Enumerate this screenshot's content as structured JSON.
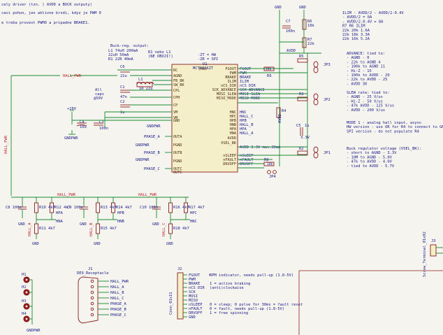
{
  "header_notes": [
    "cely driver (tzn.) AVDD a BUCK outputy)",
    "ze aktivni brzdi, kdyz je PWM 0",
    "provest PWMO a pripadne BRAKE1."
  ],
  "header_notes_real": [
    "cely driver (tzn. ) AVDD a BUCK outputy)",
    "cavi pohon, jen aktivne brzdi, kdyz je PWM 0",
    "e treba provest PWMO a pripadne BRAKE1."
  ],
  "colors": {
    "wire": "#198a32",
    "component": "#8b1c1c",
    "text": "#1a1a8c",
    "net": "#c0242b",
    "background": "#f5f4ef"
  },
  "gnd": "GND",
  "buck_note": [
    "Buck-reg. output:",
    "L1  74uH 200mA",
    "    22uH 50mA",
    "R1  22R 40mA"
  ],
  "r1_note": [
    "R1 nebo L1",
    "(NE OBOJI!)"
  ],
  "cap_note": [
    "All",
    "caps",
    "@50V"
  ],
  "u1": {
    "ref": "U1",
    "value": "MCT8316ZT",
    "hw_note": "-ZT = HW",
    "spi_note": "-ZR = SPI",
    "tag": "(HW)",
    "left_pins": [
      "RC",
      "AGND",
      "FB_BK",
      "SW_BK",
      "CPL",
      "CPH",
      "CP",
      "VM",
      "VM",
      "GND",
      "OUTA",
      "PGND",
      "OUTB",
      "PGND",
      "OUTC",
      "DVDD"
    ],
    "left_pins_real": [
      "RC",
      "AGND",
      "FB_BK",
      "SW_BK",
      "CPL",
      "CPH",
      "CP",
      "VM",
      "VM",
      "GND",
      "OUTA",
      "PGND",
      "OUTB",
      "PGND",
      "OUTC",
      "OUTC"
    ],
    "right_pins": [
      "FGOUT",
      "PWM",
      "BRAKE",
      "ILIM",
      "nCS DIR",
      "SCK ADVANCE",
      "MOSI SLEW",
      "MISO MODE",
      "HNC",
      "HALL_C",
      "HPB",
      "HALL_B",
      "HPA",
      "HALL_A",
      "AVDD",
      "VSEL_BK",
      "nSLEEP",
      "nFAULT",
      "DRVOFF"
    ],
    "right_pins_real": [
      "FGOUT",
      "PWM",
      "BRAKE",
      "ILIM",
      "nCS_DIR",
      "SCK_ADVANCE",
      "MOSI_SLEW",
      "MISO_MODE",
      "HNC",
      "HPC",
      "HPB",
      "HNB",
      "HPA",
      "HNA",
      "AVDD",
      "VSEL_BK",
      "nSLEEP",
      "nFAULT",
      "DRVOFF"
    ]
  },
  "left_components": [
    {
      "ref": "C6",
      "value": "22u"
    },
    {
      "ref": "C1",
      "value": "47n"
    },
    {
      "ref": "L1",
      "value": "1R"
    },
    {
      "ref": "R1",
      "value": "1R 22u"
    },
    {
      "ref": "C2",
      "value": "1u"
    },
    {
      "ref": "C4",
      "value": "10u"
    },
    {
      "ref": "C3",
      "value": "100n"
    }
  ],
  "left_labels": {
    "v28": "+28V",
    "gnd": "GND",
    "gndpwr": "GNDPWR",
    "hall_pwr": "HALL_PWR",
    "phase_a": "PHASE_A",
    "phase_b": "PHASE_B",
    "phase_c": "PHASE_C"
  },
  "right_labels": [
    "FGOUT",
    "PWM",
    "BRAKE",
    "ILIM",
    "nCS DIR",
    "SCK ADVANCE",
    "MOSI SLEW",
    "MISO MODE",
    "HNC",
    "HALL_C",
    "HPB",
    "HALL_B",
    "HPA",
    "HALL_A",
    "AVDD 3.3V max.30mA",
    "nSLEEP",
    "nFAULT",
    "DRVOFF"
  ],
  "right_components": [
    {
      "ref": "R9",
      "value": "10k"
    },
    {
      "ref": "R4",
      "value": "10k"
    },
    {
      "ref": "C5",
      "value": "1u"
    },
    {
      "ref": "R2",
      "value": "10k"
    },
    {
      "ref": "R8",
      "value": "10k"
    },
    {
      "ref": "JP4",
      "value": ""
    },
    {
      "ref": "R3",
      "value": "10k"
    },
    {
      "ref": "R5",
      "value": "10k"
    },
    {
      "ref": "C7",
      "value": "100n"
    },
    {
      "ref": "R6",
      "value": "18k"
    },
    {
      "ref": "R7",
      "value": "22k"
    }
  ],
  "jumpers": [
    "JP3",
    "JP2",
    "JP1"
  ],
  "avdd_label": "AVDD",
  "avdd_v": "3.3V",
  "ilim_note": [
    "ILIM - AVDD/2 - AVDD/2-0.4V",
    "- AVDD/2 = 0A",
    "- AVDD/2-0.4V = 8A",
    "R7   R6   ILIM",
    "22k  20k  1.6A",
    "22k  18k  3.3A",
    "22k  16k  5.2A"
  ],
  "advance_note": [
    "ADVANCE: tied to:",
    "- AGND - 0",
    "- 22k to AGND 4",
    "- 100k to AGND 11",
    "- Hi-Z - 15",
    "- 100k to AVDD - 20",
    "- 22k to AVDD - 25",
    "- AVDD 30"
  ],
  "slew_note": [
    "SLEW rate: tied to:",
    "- AGND - 25 V/us",
    "- Hi-Z - 50 V/us",
    "- 47k AVDD - 125 V/us",
    "- AVDD - 200 V/us"
  ],
  "mode_note": [
    "MODE 1 - analog hall input, async",
    "HW version - use OR for R4 to connect to GND",
    "SPI version - do not populate R4"
  ],
  "buck_v_note": [
    "Buck regulator voltage (VSEL_BK):",
    "- short to AGND - 3.3V",
    "- 10M to AGND - 5.0V",
    "- 47k to AVDD - 4.0V",
    "- tied to AVDD - 5.7V"
  ],
  "hall_sections": [
    {
      "caps": [
        {
          "ref": "C8",
          "value": "100n"
        }
      ],
      "res": [
        {
          "ref": "R10",
          "value": "4k7"
        },
        {
          "ref": "R11",
          "value": "4k7"
        }
      ],
      "net": "HALL_A",
      "hp": "HPA",
      "hn": "HNA",
      "r0": "R10",
      "r0v": "4k7"
    },
    {
      "caps": [
        {
          "ref": "C9",
          "value": "100n"
        }
      ],
      "res": [
        {
          "ref": "R13",
          "value": "4k7"
        },
        {
          "ref": "R14",
          "value": "4k7"
        },
        {
          "ref": "R15",
          "value": "4k7"
        }
      ],
      "net": "HALL_B",
      "hp": "HPB",
      "hn": "HNB"
    },
    {
      "caps": [
        {
          "ref": "C10",
          "value": "100n"
        }
      ],
      "res": [
        {
          "ref": "R16",
          "value": "4k7"
        },
        {
          "ref": "R17",
          "value": "4k7"
        },
        {
          "ref": "R18",
          "value": "4k7"
        }
      ],
      "net": "HALL_C",
      "hp": "HPC",
      "hn": "HNC"
    }
  ],
  "hall_sections_real": [
    {
      "cap": "C8 100n",
      "r_top": "R10 4k7",
      "r_mid": "R12 4k7",
      "r_bot": "R11 4k7",
      "net": "HALL_A",
      "hp": "HPA",
      "hn": "HNA"
    },
    {
      "cap": "C9 100n",
      "r_top": "R13 4k7",
      "r_mid": "R14 4k7",
      "r_bot": "R15 4k7",
      "net": "HALL_B",
      "hp": "HPB",
      "hn": "HNB"
    },
    {
      "cap": "C10 100n",
      "r_top": "R16 4k7",
      "r_mid": "R17 4k7",
      "r_bot": "R18 4k7",
      "net": "HALL_C",
      "hp": "HPC",
      "hn": "HNC"
    }
  ],
  "mounting_holes": [
    "H1",
    "H2",
    "H3",
    "H4"
  ],
  "j1": {
    "ref": "J1",
    "value": "DE9_Receptacle",
    "pins": [
      "HALL_PWR",
      "HALL_A",
      "HALL_B",
      "HALL_C",
      "PHASE_A",
      "PHASE_B",
      "PHASE_C"
    ]
  },
  "j2": {
    "ref": "J2",
    "value": "Conn_01x11",
    "pins": [
      "FGOUT",
      "PWM",
      "BRAKE",
      "nCS DIR",
      "SCK",
      "MOSI",
      "MISO",
      "nSLEEP",
      "nFAULT",
      "DRVOFF",
      "GND"
    ],
    "notes": [
      "RPM indicator, needs pull-up (1.8-5V)",
      "",
      "1 = active braking",
      "(anti)clockwise",
      "",
      "",
      "",
      "0 = sleep; 0 pulse for 30ms = fault reset",
      "0 = fault, needs pull-up (1.8-5V)",
      "1 = free spinning",
      ""
    ]
  },
  "j3": {
    "ref": "J3",
    "value": "Screw_Terminal_01x02"
  },
  "gndpwr": "GNDPWR"
}
